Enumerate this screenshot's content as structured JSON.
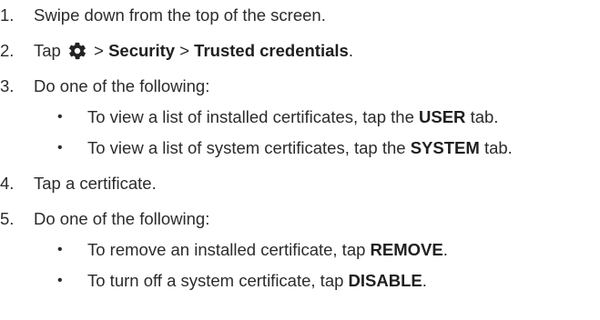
{
  "steps": [
    {
      "num": "1.",
      "text": "Swipe down from the top of the screen."
    },
    {
      "num": "2.",
      "prefix": "Tap",
      "icon": "gear-icon",
      "sep1": ">",
      "security": "Security",
      "sep2": ">",
      "trusted": "Trusted credentials",
      "end": "."
    },
    {
      "num": "3.",
      "text": "Do one of the following:",
      "subitems": [
        {
          "bullet": "•",
          "pre": "To view a list of installed certificates, tap the",
          "bold": "USER",
          "post": "tab."
        },
        {
          "bullet": "•",
          "pre": "To view a list of system certificates, tap the",
          "bold": "SYSTEM",
          "post": "tab."
        }
      ]
    },
    {
      "num": "4.",
      "text": "Tap a certificate."
    },
    {
      "num": "5.",
      "text": "Do one of the following:",
      "subitems": [
        {
          "bullet": "•",
          "pre": "To remove an installed certificate, tap",
          "bold": "REMOVE",
          "post": "."
        },
        {
          "bullet": "•",
          "pre": "To turn off a system certificate, tap",
          "bold": "DISABLE",
          "post": "."
        }
      ]
    }
  ]
}
